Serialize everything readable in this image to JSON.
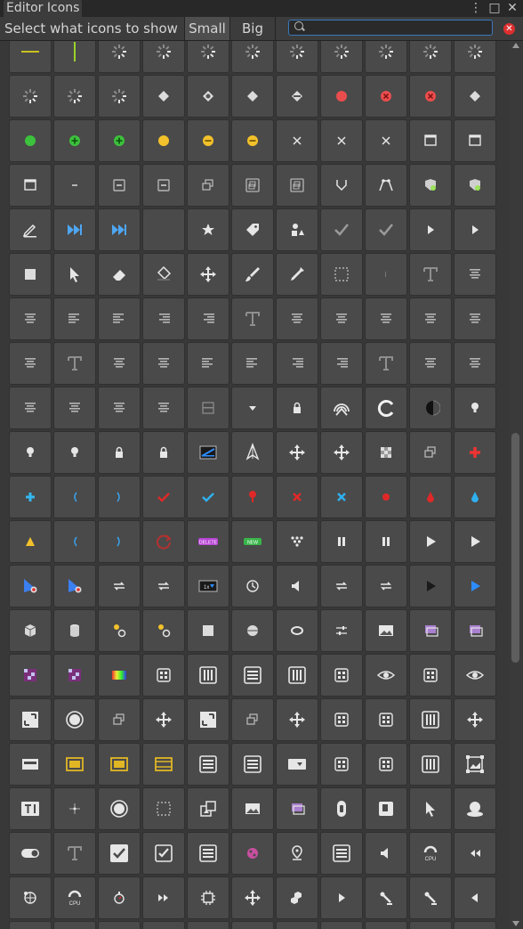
{
  "window": {
    "title": "Editor Icons",
    "buttons": [
      "menu-dots",
      "maximize",
      "close"
    ]
  },
  "toolbar": {
    "label": "Select what icons to show",
    "tabs": [
      {
        "label": "Small",
        "selected": true
      },
      {
        "label": "Big",
        "selected": false
      }
    ],
    "search_value": ""
  },
  "colors": {
    "background": "#383838",
    "cell": "#4a4a4a",
    "accent_blue": "#3a79bb",
    "red": "#ea4d4d",
    "green": "#3cc23c",
    "yellow": "#f2c12b"
  },
  "grid": {
    "columns": 11,
    "rows": [
      [
        "gradient-line",
        "vertical-line",
        "spinner",
        "spinner",
        "spinner",
        "spinner",
        "spinner",
        "spinner",
        "spinner",
        "spinner",
        "spinner"
      ],
      [
        "spinner",
        "spinner",
        "spinner",
        "collab-icon",
        "collab-error-icon",
        "collab-icon",
        "collab-conflict-icon",
        "red-dot",
        "red-x-circle",
        "red-x-circle",
        "collab-icon"
      ],
      [
        "green-dot",
        "green-plus-circle",
        "green-plus-circle",
        "yellow-dot",
        "yellow-minus-circle",
        "yellow-minus-circle",
        "x-mark",
        "x-mark",
        "x-mark",
        "window-icon",
        "window-icon"
      ],
      [
        "window-icon",
        "minimize-icon",
        "minimize-box-icon",
        "minimize-box-icon",
        "restore-icon",
        "restore-box-icon",
        "restore-box-icon",
        "merge-icon",
        "graph-icon",
        "avatar-icon",
        "avatar-icon"
      ],
      [
        "pencil-icon",
        "skip-forward-icon",
        "skip-forward-icon",
        "blank",
        "star-icon",
        "tag-icon",
        "shapes-icon",
        "check-icon",
        "check-icon",
        "play-small-icon",
        "play-small-icon"
      ],
      [
        "square-icon",
        "cursor-icon",
        "eraser-icon",
        "paint-bucket-icon",
        "move-icon",
        "brush-icon",
        "eyedropper-icon",
        "rect-select-icon",
        "vertical-line-small",
        "text-icon",
        "align-center-icon"
      ],
      [
        "align-center-icon",
        "align-left-icon",
        "align-left-icon",
        "align-right-icon",
        "align-right-icon",
        "text-icon",
        "align-center-icon",
        "align-center-icon",
        "align-center-icon",
        "align-center-icon",
        "align-center-icon"
      ],
      [
        "align-center-icon",
        "text-icon",
        "align-center-icon",
        "align-center-icon",
        "align-left-icon",
        "align-left-icon",
        "align-right-icon",
        "align-right-icon",
        "text-icon",
        "align-center-icon",
        "align-center-icon"
      ],
      [
        "align-center-icon",
        "align-center-icon",
        "align-center-icon",
        "align-center-icon",
        "divider-box-icon",
        "dropdown-icon",
        "lock-icon",
        "radar-icon",
        "refresh-icon",
        "half-circle-icon",
        "light-icon"
      ],
      [
        "light-icon",
        "light-icon",
        "lock-icon",
        "lock-icon",
        "blue-chart-icon",
        "split-icon",
        "move-icon",
        "move-icon",
        "checker-icon",
        "restore-icon",
        "red-plus-icon"
      ],
      [
        "blue-plus-icon",
        "paren-left-icon",
        "paren-right-icon",
        "red-check-icon",
        "blue-check-icon",
        "red-pin-icon",
        "red-x-icon",
        "blue-x-icon",
        "red-dot-small",
        "red-drop-icon",
        "blue-drop-icon"
      ],
      [
        "yellow-triangle-icon",
        "paren-left-icon",
        "paren-right-icon",
        "red-refresh-icon",
        "delete-badge-icon",
        "new-badge-icon",
        "dots-icon",
        "pause-icon",
        "pause-icon",
        "play-icon",
        "play-icon"
      ],
      [
        "flag-record-icon",
        "flag-record-icon",
        "loop-icon",
        "loop-icon",
        "speed-icon",
        "clock-icon",
        "audio-icon",
        "loop-icon",
        "loop-icon",
        "play-dark-icon",
        "play-blue-icon"
      ],
      [
        "cube-icon",
        "cylinder-icon",
        "spheres-icon",
        "spheres-icon",
        "square-icon",
        "sphere-icon",
        "capsule-icon",
        "sliders-icon",
        "image-icon",
        "layers-icon",
        "layers-icon"
      ],
      [
        "checker-pink-icon",
        "checker-pink-icon",
        "rainbow-icon",
        "grid-icon",
        "columns-icon",
        "rows-icon",
        "columns-icon",
        "grid-icon",
        "eye-icon",
        "grid-icon",
        "eye-icon"
      ],
      [
        "maximize-icon",
        "circle-icon",
        "restore-icon",
        "move-icon",
        "maximize-icon",
        "restore-icon",
        "move-icon",
        "grid-icon",
        "grid-icon",
        "columns-icon",
        "move-icon"
      ],
      [
        "keyboard-icon",
        "yellow-box-icon",
        "yellow-box-icon",
        "film-icon",
        "rows-icon",
        "rows-icon",
        "dropdown-box-icon",
        "grid-icon",
        "grid-icon",
        "columns-icon",
        "image-frame-icon"
      ],
      [
        "text-field-icon",
        "cross-icon",
        "circle-icon",
        "rect-select-icon",
        "transform-icon",
        "image-icon",
        "layers-icon",
        "scrollbar-icon",
        "panel-icon",
        "cursor-icon",
        "dome-icon"
      ],
      [
        "toggle-icon",
        "text-icon",
        "checkbox-icon",
        "checklist-icon",
        "rows-icon",
        "pink-icon",
        "pin-icon",
        "rows-icon",
        "audio-icon",
        "cpu-icon",
        "rewind-icon"
      ],
      [
        "globe-icon",
        "cpu-icon",
        "stopwatch-icon",
        "fast-forward-icon",
        "cpu-chip-icon",
        "move-icon",
        "cubes-icon",
        "play-small-icon",
        "bone-icon",
        "bone-icon",
        "play-left-icon"
      ],
      [
        "blank",
        "blank",
        "blank",
        "blank",
        "blank",
        "blank",
        "blank",
        "blank",
        "blank",
        "blank",
        "blank"
      ]
    ]
  }
}
